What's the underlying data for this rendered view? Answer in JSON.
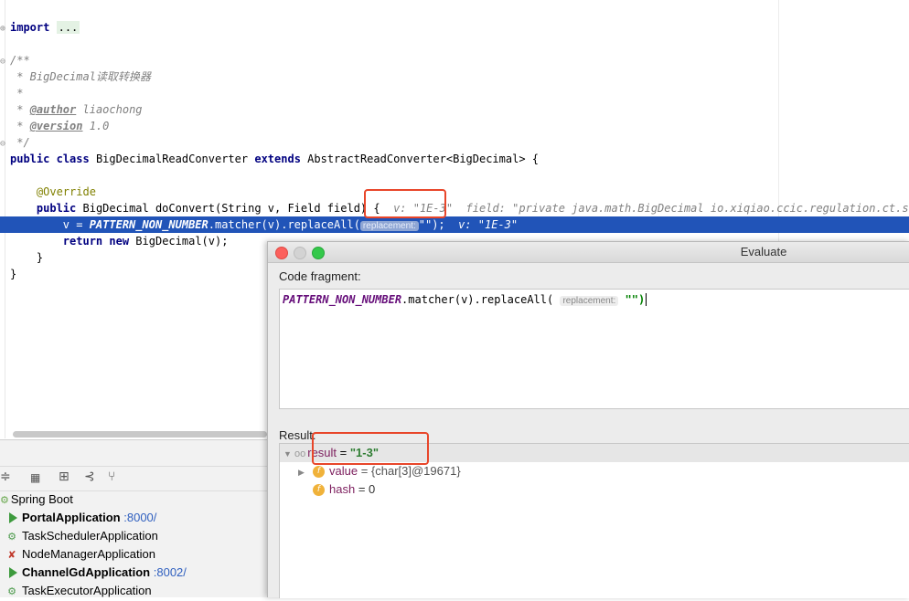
{
  "editor": {
    "lines": {
      "import": "import",
      "import_dots": "...",
      "doc_open": "/**",
      "doc_desc": " * BigDecimal读取转换器",
      "doc_blank": " *",
      "doc_author_star": " * ",
      "doc_author_tag": "@author",
      "doc_author_val": " liaochong",
      "doc_version_star": " * ",
      "doc_version_tag": "@version",
      "doc_version_val": " 1.0",
      "doc_close": " */",
      "class_public": "public",
      "class_class": "class",
      "class_name": " BigDecimalReadConverter ",
      "class_extends": "extends",
      "class_rest": " AbstractReadConverter<BigDecimal> {",
      "override": "@Override",
      "method_public": "public",
      "method_sig": " BigDecimal doConvert(String v, Field field) {",
      "method_hint_v": "v: \"1E-3\"",
      "method_hint_field": "field: \"private java.math.BigDecimal io.xiqiao.ccic.regulation.ct.service",
      "hl_assign": "v = ",
      "hl_const": "PATTERN_NON_NUMBER",
      "hl_call": ".matcher(v).replaceAll(",
      "hl_param": "replacement:",
      "hl_arg": "\"\"",
      "hl_end": ");",
      "hl_hint_v": "v: \"1E-3\"",
      "return_kw": "return",
      "return_new": "new",
      "return_rest": " BigDecimal(v);",
      "close_method": "}",
      "close_class": "}"
    }
  },
  "run_panel": {
    "toolbar_icons": [
      "collapse-all-icon",
      "group-icon",
      "add-config-icon",
      "branch-icon",
      "filter-icon"
    ],
    "header": "Spring Boot",
    "apps": [
      {
        "name": "PortalApplication",
        "port": ":8000/",
        "running": true
      },
      {
        "name": "TaskSchedulerApplication",
        "port": "",
        "running": false
      },
      {
        "name": "NodeManagerApplication",
        "port": "",
        "running": false
      },
      {
        "name": "ChannelGdApplication",
        "port": ":8002/",
        "running": true
      },
      {
        "name": "TaskExecutorApplication",
        "port": "",
        "running": false
      }
    ]
  },
  "evaluate": {
    "title": "Evaluate",
    "code_label": "Code fragment:",
    "code_const": "PATTERN_NON_NUMBER",
    "code_call": ".matcher(v).replaceAll(",
    "code_param": "replacement:",
    "code_arg": "\"\")",
    "result_label": "Result:",
    "result_name": "result",
    "result_eq": " = ",
    "result_value": "\"1-3\"",
    "children": [
      {
        "name": "value",
        "value": " = {char[3]@19671}"
      },
      {
        "name": "hash",
        "value": " = 0"
      }
    ]
  },
  "colors": {
    "highlight": "#2154b8",
    "annotation_box": "#e8462a",
    "traffic_close": "#fc605c",
    "traffic_min": "#cfcfcf",
    "traffic_max": "#34c84a"
  }
}
